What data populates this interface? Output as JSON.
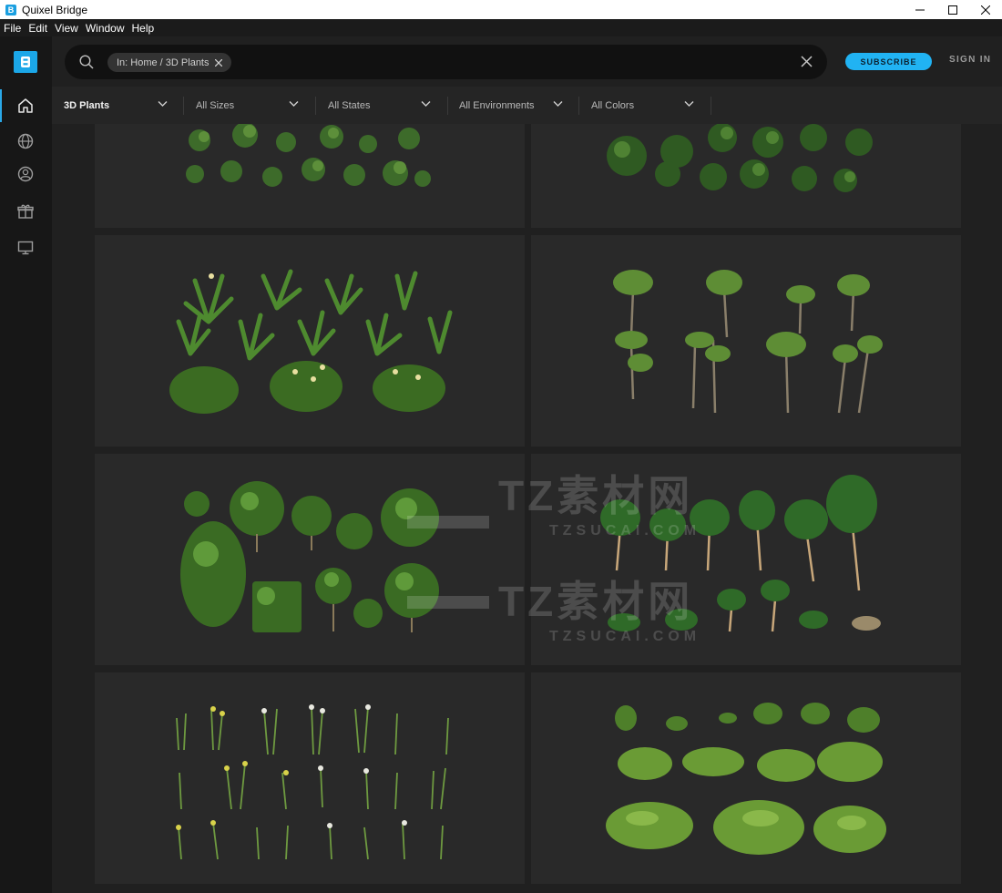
{
  "window": {
    "title": "Quixel Bridge",
    "app_icon_letter": "B"
  },
  "menu": [
    "File",
    "Edit",
    "View",
    "Window",
    "Help"
  ],
  "sidebar": {
    "logo_letter": "B",
    "items": [
      {
        "icon": "home-icon",
        "active": true
      },
      {
        "icon": "globe-icon",
        "active": false
      },
      {
        "icon": "user-icon",
        "active": false
      },
      {
        "icon": "gift-icon",
        "active": false
      },
      {
        "icon": "monitor-icon",
        "active": false
      }
    ]
  },
  "search": {
    "chip_label": "In: Home / 3D Plants",
    "placeholder": ""
  },
  "header": {
    "subscribe_label": "SUBSCRIBE",
    "signin_label": "SIGN IN"
  },
  "filters": [
    "3D Plants",
    "All Sizes",
    "All States",
    "All Environments",
    "All Colors"
  ],
  "watermark": {
    "brand": "TZ素材网",
    "url": "TZSUCAI.COM"
  },
  "colors": {
    "accent": "#21b3f3",
    "background": "#202020",
    "card": "#292929",
    "sidebar": "#171717"
  },
  "cards": [
    {
      "kind": "groundcover-vines"
    },
    {
      "kind": "leafy-shrubs"
    },
    {
      "kind": "tropical-lilies"
    },
    {
      "kind": "palm-trees"
    },
    {
      "kind": "round-bushes"
    },
    {
      "kind": "dracaena-palms"
    },
    {
      "kind": "daffodil-flowers"
    },
    {
      "kind": "ferns"
    }
  ]
}
